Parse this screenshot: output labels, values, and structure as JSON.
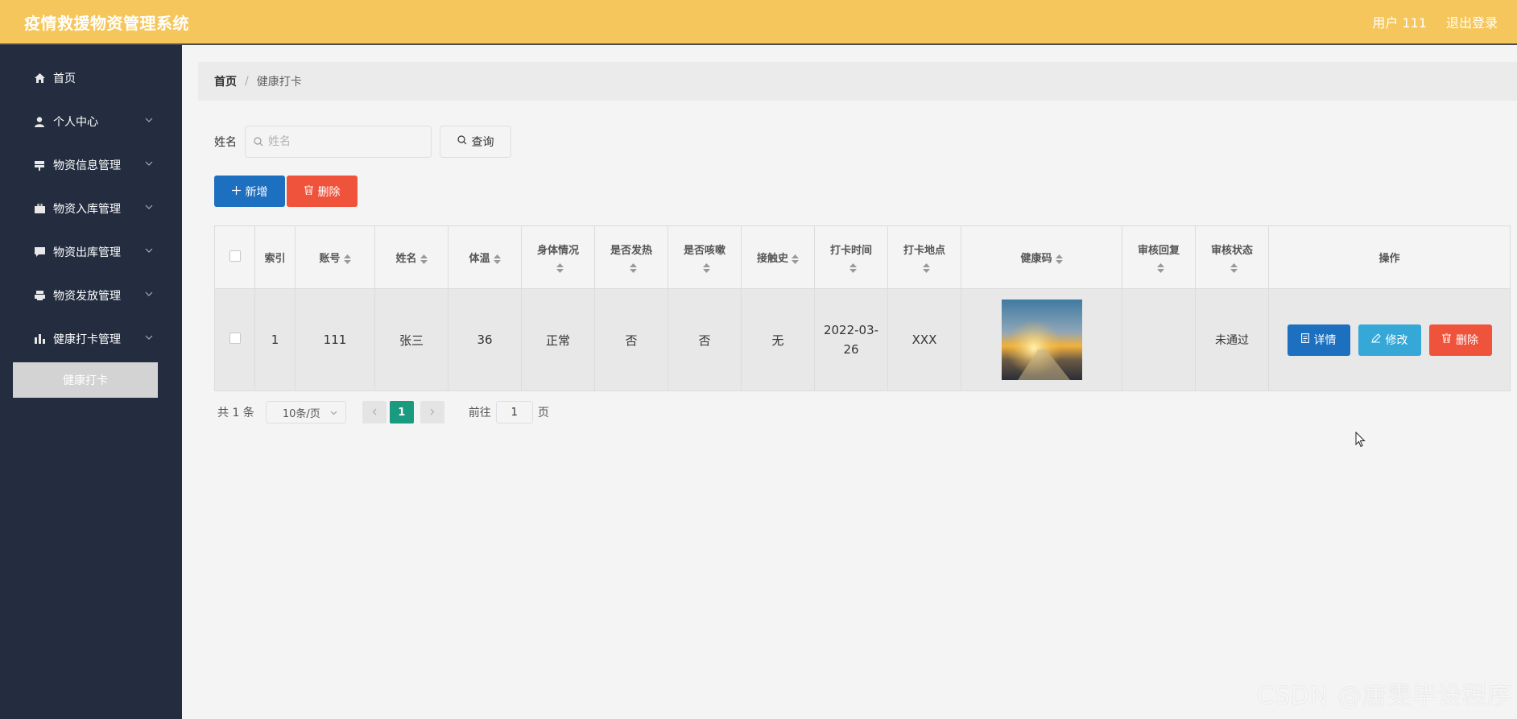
{
  "header": {
    "app_title": "疫情救援物资管理系统",
    "user_label": "用户 111",
    "logout_label": "退出登录"
  },
  "sidebar": {
    "items": [
      {
        "label": "首页",
        "icon": "home-icon",
        "expandable": false
      },
      {
        "label": "个人中心",
        "icon": "user-icon",
        "expandable": true
      },
      {
        "label": "物资信息管理",
        "icon": "signpost-icon",
        "expandable": true
      },
      {
        "label": "物资入库管理",
        "icon": "briefcase-icon",
        "expandable": true
      },
      {
        "label": "物资出库管理",
        "icon": "chat-icon",
        "expandable": true
      },
      {
        "label": "物资发放管理",
        "icon": "printer-icon",
        "expandable": true
      },
      {
        "label": "健康打卡管理",
        "icon": "bar-chart-icon",
        "expandable": true
      }
    ],
    "active_subitem": "健康打卡"
  },
  "breadcrumb": {
    "home": "首页",
    "separator": "/",
    "current": "健康打卡"
  },
  "search": {
    "label": "姓名",
    "placeholder": "姓名",
    "value": "",
    "query_button": "查询"
  },
  "actions": {
    "add_label": "新增",
    "delete_label": "删除"
  },
  "table": {
    "columns": [
      "索引",
      "账号",
      "姓名",
      "体温",
      "身体情况",
      "是否发热",
      "是否咳嗽",
      "接触史",
      "打卡时间",
      "打卡地点",
      "健康码",
      "审核回复",
      "审核状态",
      "操作"
    ],
    "rows": [
      {
        "index": "1",
        "account": "111",
        "name": "张三",
        "temperature": "36",
        "condition": "正常",
        "fever": "否",
        "cough": "否",
        "contact": "无",
        "checkin_time": "2022-03-26",
        "location": "XXX",
        "review_reply": "",
        "review_status": "未通过"
      }
    ],
    "row_actions": {
      "detail": "详情",
      "edit": "修改",
      "delete": "删除"
    }
  },
  "pagination": {
    "total": "共 1 条",
    "page_size": "10条/页",
    "current_page": "1",
    "goto_prefix": "前往",
    "goto_value": "1",
    "goto_suffix": "页"
  },
  "watermark": "CSDN @唐雯毕设程序",
  "colors": {
    "header_bg": "#f5c65b",
    "sidebar_bg": "#232d3f",
    "primary_blue": "#1d6fbf",
    "danger_red": "#f0533b",
    "edit_cyan": "#35a8d8",
    "pager_active": "#1a9a7e"
  }
}
